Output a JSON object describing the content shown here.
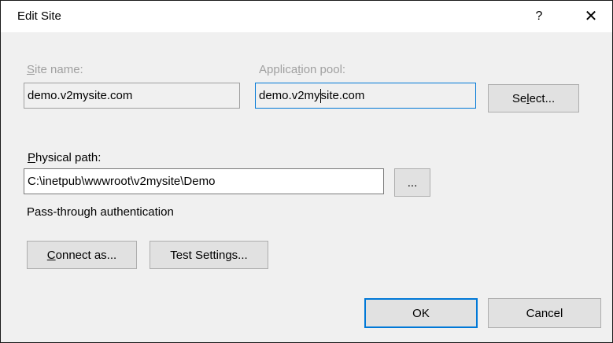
{
  "window": {
    "title": "Edit Site",
    "help_glyph": "?",
    "close_glyph": "✕"
  },
  "site_name": {
    "label_accel": "S",
    "label_rest": "ite name:",
    "value": "demo.v2mysite.com"
  },
  "app_pool": {
    "label_pre": "Applica",
    "label_accel": "t",
    "label_rest": "ion pool:",
    "value_before_caret": "demo.v2my",
    "value_after_caret": "site.com",
    "select_pre": "Se",
    "select_accel": "l",
    "select_rest": "ect..."
  },
  "physical_path": {
    "label_accel": "P",
    "label_rest": "hysical path:",
    "value": "C:\\inetpub\\wwwroot\\v2mysite\\Demo",
    "browse_label": "..."
  },
  "auth": {
    "text": "Pass-through authentication",
    "connect_accel": "C",
    "connect_rest": "onnect as...",
    "test_settings_label": "Test Settings..."
  },
  "footer": {
    "ok_label": "OK",
    "cancel_label": "Cancel"
  },
  "colors": {
    "focus_border": "#0078d7",
    "disabled_text": "#a0a0a0"
  }
}
